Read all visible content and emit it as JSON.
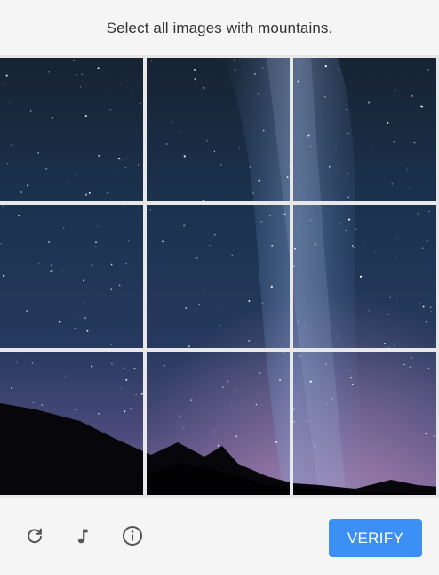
{
  "instruction": "Select all images with mountains.",
  "grid": {
    "tiles": [
      {
        "row": 1,
        "col": 1
      },
      {
        "row": 1,
        "col": 2
      },
      {
        "row": 1,
        "col": 3
      },
      {
        "row": 2,
        "col": 1
      },
      {
        "row": 2,
        "col": 2
      },
      {
        "row": 2,
        "col": 3
      },
      {
        "row": 3,
        "col": 1
      },
      {
        "row": 3,
        "col": 2
      },
      {
        "row": 3,
        "col": 3
      }
    ]
  },
  "footer": {
    "reload_icon": "reload-icon",
    "audio_icon": "audio-icon",
    "info_icon": "info-icon",
    "verify_label": "VERIFY"
  },
  "colors": {
    "accent": "#3b8ff5",
    "icon": "#555555",
    "sky_top": "#152235",
    "sky_bottom": "#6a5c8e"
  }
}
